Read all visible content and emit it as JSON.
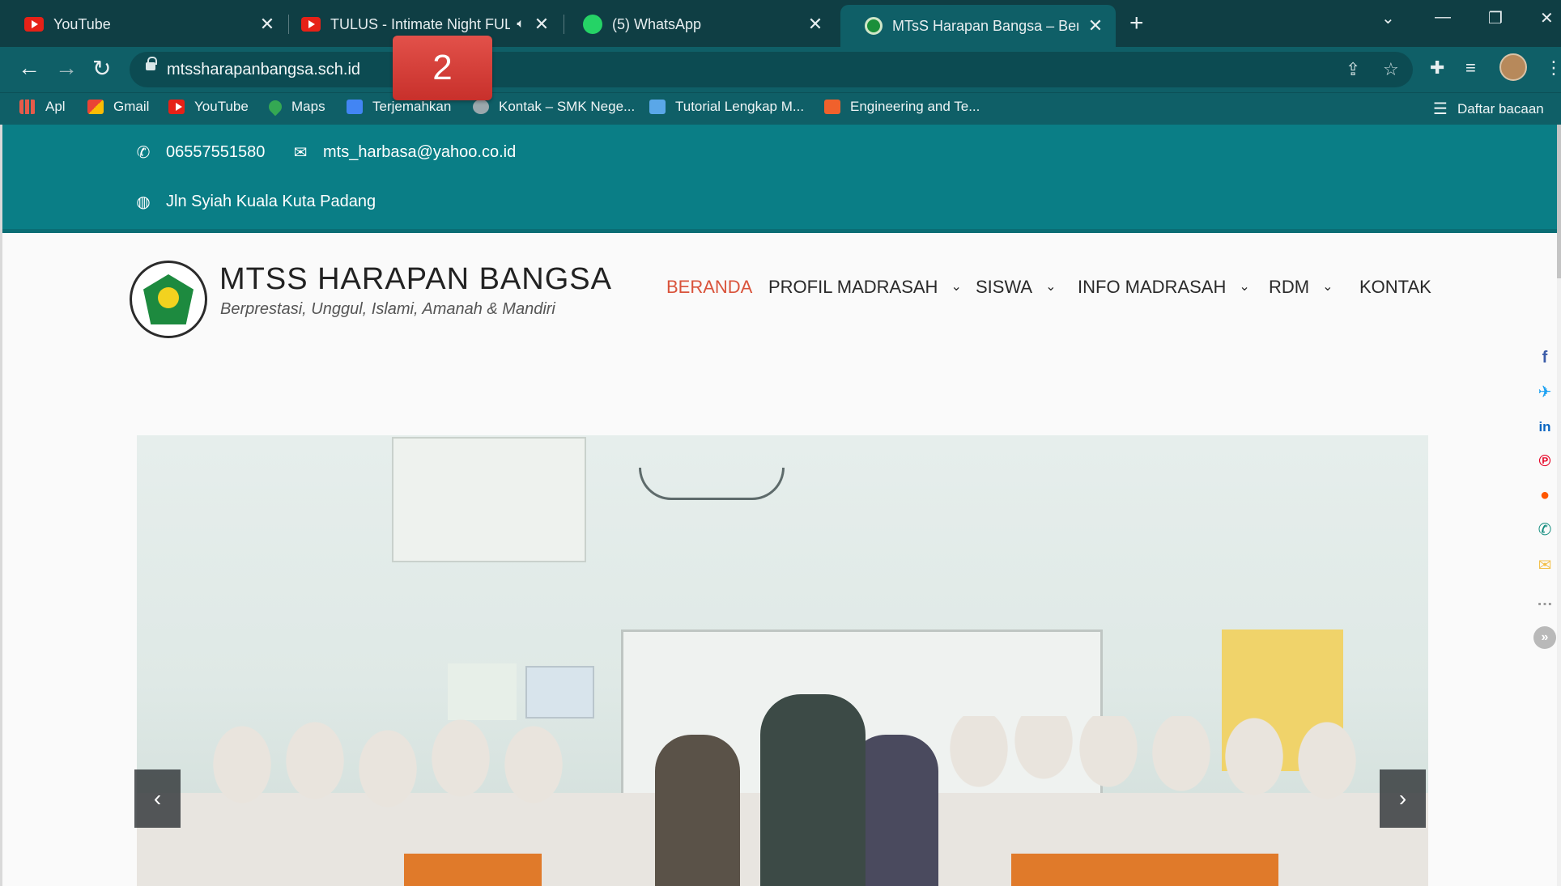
{
  "tabs": [
    {
      "title": "YouTube",
      "icon": "youtube-icon"
    },
    {
      "title": "TULUS - Intimate Night FULL",
      "icon": "youtube-icon",
      "audio": true
    },
    {
      "title": "(5) WhatsApp",
      "icon": "whatsapp-icon"
    },
    {
      "title": "MTsS Harapan Bangsa – Berprest",
      "icon": "school-logo-icon",
      "active": true
    }
  ],
  "toolbar": {
    "url": "mtssharapanbangsa.sch.id"
  },
  "bookmarks": [
    {
      "label": "Apl",
      "icon": "apps-grid-icon"
    },
    {
      "label": "Gmail",
      "icon": "gmail-icon"
    },
    {
      "label": "YouTube",
      "icon": "youtube-icon"
    },
    {
      "label": "Maps",
      "icon": "maps-icon"
    },
    {
      "label": "Terjemahkan",
      "icon": "translate-icon"
    },
    {
      "label": "Kontak – SMK Nege...",
      "icon": "site-icon"
    },
    {
      "label": "Tutorial Lengkap M...",
      "icon": "tutorial-icon"
    },
    {
      "label": "Engineering and Te...",
      "icon": "engineering-icon"
    }
  ],
  "reading_list": "Daftar bacaan",
  "overlay_badge": "2",
  "topbar": {
    "phone": "06557551580",
    "email": "mts_harbasa@yahoo.co.id",
    "address": "Jln Syiah Kuala Kuta Padang"
  },
  "site": {
    "title": "MTSS HARAPAN BANGSA",
    "tagline": "Berprestasi, Unggul, Islami, Amanah & Mandiri"
  },
  "nav": [
    {
      "label": "BERANDA",
      "current": true,
      "dropdown": false
    },
    {
      "label": "PROFIL MADRASAH",
      "dropdown": true
    },
    {
      "label": "SISWA",
      "dropdown": true
    },
    {
      "label": "INFO MADRASAH",
      "dropdown": true
    },
    {
      "label": "RDM",
      "dropdown": true
    },
    {
      "label": "KONTAK",
      "dropdown": false
    }
  ],
  "share_icons": [
    "facebook-icon",
    "twitter-icon",
    "linkedin-icon",
    "pinterest-icon",
    "reddit-icon",
    "whatsapp-icon",
    "email-icon",
    "more-icon",
    "collapse-icon"
  ],
  "colors": {
    "tab_strip": "#0f3e44",
    "toolbar": "#0f5f67",
    "topbar": "#0a7e86",
    "nav_active": "#d9533b",
    "badge": "#d33b35"
  }
}
